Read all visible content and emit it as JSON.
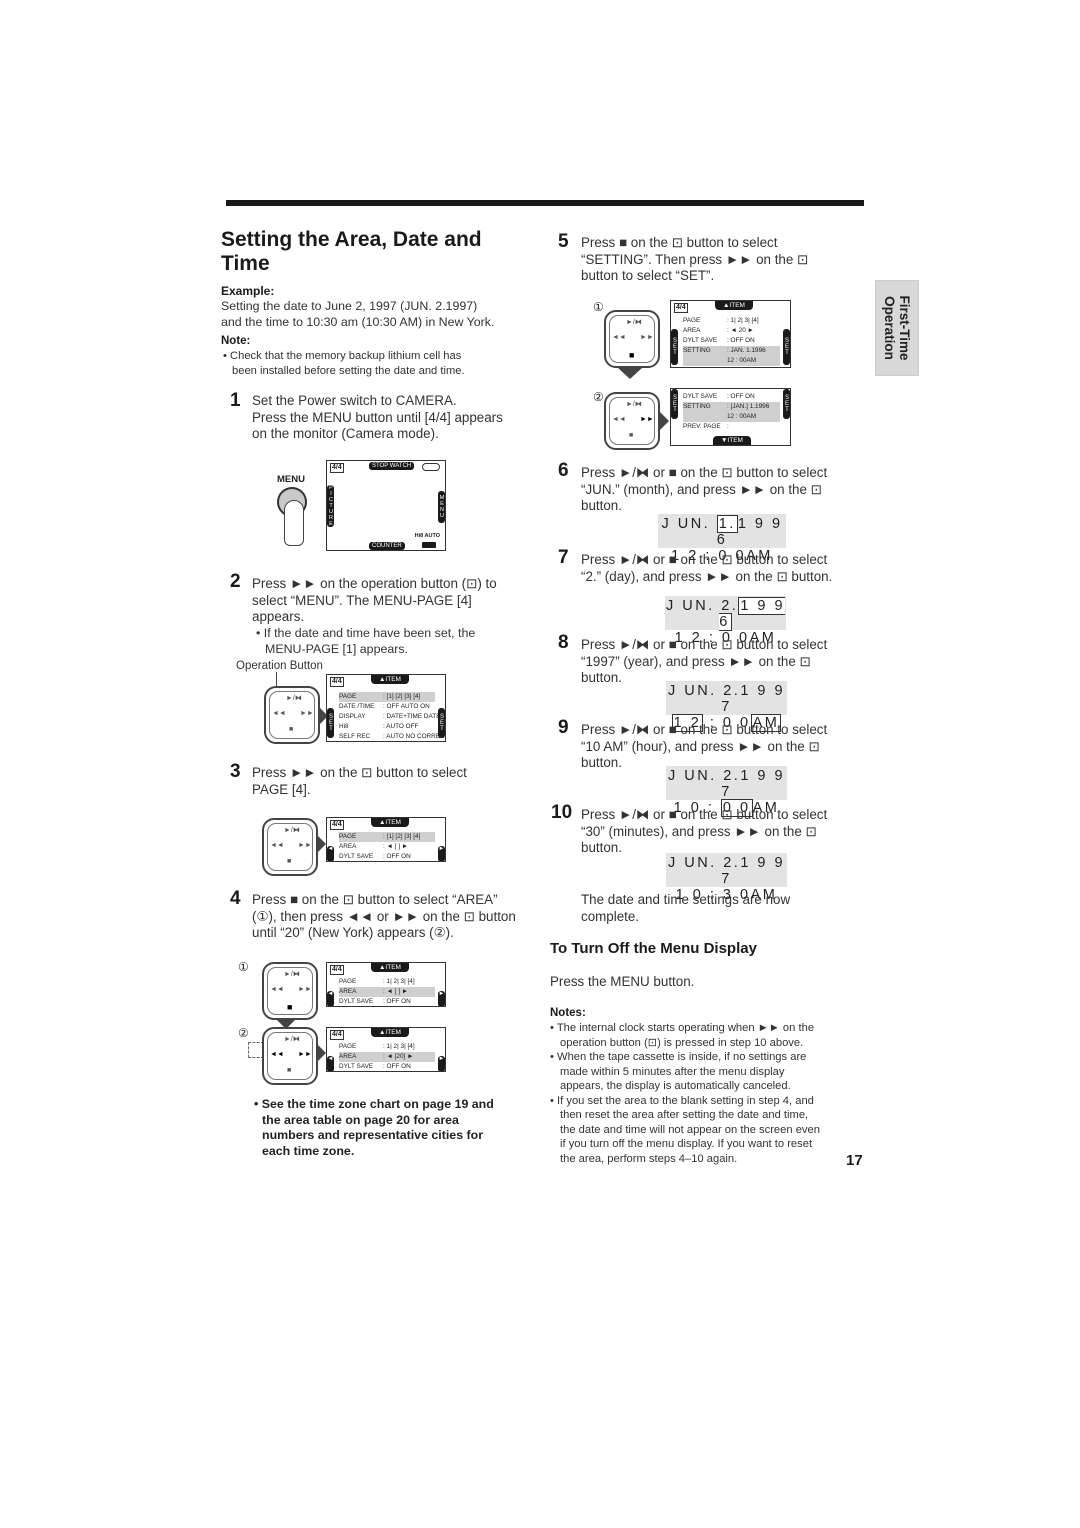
{
  "page": {
    "title": "Setting the Area, Date and Time",
    "section_tab": [
      "First-Time",
      "Operation"
    ],
    "page_number": "17"
  },
  "intro": {
    "example_label": "Example:",
    "example_lines": [
      "Setting the date to June 2, 1997 (JUN. 2.1997)",
      "and the time to 10:30 am (10:30 AM) in New York."
    ],
    "note_label": "Note:",
    "note_lines": [
      "• Check that the memory backup lithium cell has",
      "been installed before setting the date and time."
    ]
  },
  "steps": [
    {
      "num": "1",
      "lines": [
        "Set the Power switch to CAMERA.",
        "Press the MENU button until [4/4] appears",
        "on the monitor (Camera mode)."
      ]
    },
    {
      "num": "2",
      "lines": [
        "Press ►► on the operation button (⊡) to",
        "select “MENU”. The MENU-PAGE [4]",
        "appears."
      ],
      "bullet": [
        "• If the date and time have been set, the",
        "MENU-PAGE [1] appears."
      ]
    },
    {
      "num": "3",
      "lines": [
        "Press ►► on the ⊡ button to select",
        "PAGE [4]."
      ]
    },
    {
      "num": "4",
      "lines": [
        "Press ■ on the ⊡ button to select “AREA”",
        "(①), then press ◄◄ or ►► on the ⊡ button",
        "until “20” (New York) appears (②)."
      ]
    },
    {
      "num": "5",
      "lines": [
        "Press ■ on the ⊡ button to select",
        "“SETTING”. Then press ►► on the ⊡",
        "button to select “SET”."
      ]
    },
    {
      "num": "6",
      "lines": [
        "Press ►/⧓ or ■ on the ⊡ button to select",
        "“JUN.” (month), and press ►► on the ⊡",
        "button."
      ]
    },
    {
      "num": "7",
      "lines": [
        "Press ►/⧓ or ■ on the ⊡ button to select",
        "“2.” (day), and press ►► on the ⊡ button."
      ]
    },
    {
      "num": "8",
      "lines": [
        "Press ►/⧓ or ■ on the ⊡ button to select",
        "“1997” (year), and press ►► on the ⊡",
        "button."
      ]
    },
    {
      "num": "9",
      "lines": [
        "Press ►/⧓ or ■ on the ⊡ button to select",
        "“10 AM” (hour), and press ►► on the ⊡",
        "button."
      ]
    },
    {
      "num": "10",
      "lines": [
        "Press ►/⧓ or ■ on the ⊡ button to select",
        "“30” (minutes), and press ►► on the ⊡",
        "button."
      ]
    }
  ],
  "date_displays": [
    {
      "date": "J UN.",
      "day": "1.",
      "year": "1 9 9 6",
      "hour": "1 2",
      "min": "0 0",
      "ampm": "AM",
      "focus": "day"
    },
    {
      "date": "J UN.",
      "day": "2.",
      "year": "1 9 9 6",
      "hour": "1 2",
      "min": "0 0",
      "ampm": "AM",
      "focus": "year"
    },
    {
      "date": "J UN.",
      "day": "2.",
      "year": "1 9 9 7",
      "hour": "1 2",
      "min": "0 0",
      "ampm": "AM",
      "focus": "hour"
    },
    {
      "date": "J UN.",
      "day": "2.",
      "year": "1 9 9 7",
      "hour": "1 0",
      "min": "0 0",
      "ampm": "AM",
      "focus": "min"
    },
    {
      "date": "J UN.",
      "day": "2.",
      "year": "1 9 9 7",
      "hour": "1 0",
      "min": "3 0",
      "ampm": "AM",
      "focus": "none"
    }
  ],
  "complete_text": [
    "The date and time settings are now",
    "complete."
  ],
  "turn_off": {
    "heading": "To Turn Off the Menu Display",
    "text": "Press the MENU button."
  },
  "notes": {
    "label": "Notes:",
    "items": [
      [
        "• The internal clock starts operating when ►► on the",
        "operation button (⊡) is pressed in step 10 above."
      ],
      [
        "• When the tape cassette is inside, if no settings are",
        "made within 5 minutes after the menu display",
        "appears, the display is automatically canceled."
      ],
      [
        "• If you set the area to the blank setting in step 4, and",
        "then reset the area after setting the date and time,",
        "the date and time will not appear on the screen even",
        "if you turn off the menu display. If you want to reset",
        "the area, perform steps 4–10 again."
      ]
    ]
  },
  "see_also": [
    "• See the time zone chart on page 19 and",
    "the area table on page 20 for area",
    "numbers and representative cities for",
    "each time zone."
  ],
  "figures": {
    "menu_button_label": "MENU",
    "operation_button_label": "Operation Button",
    "circle_1": "①",
    "circle_2": "②",
    "pad_glyphs": {
      "play": "►/⧓",
      "rew": "◄◄",
      "ff": "►►",
      "stop": "■"
    },
    "camera_screen": {
      "badge": "4/4",
      "top": "STOP WATCH",
      "bottom": "COUNTER",
      "left": "PICTURE",
      "right": "MENU",
      "hi8": "Hi8 AUTO"
    },
    "menu_item_tab": "▲ITEM",
    "menu_item_tab_down": "▼ITEM",
    "set_label": "SET",
    "menu_page4_full": [
      {
        "k": "PAGE",
        "v": ": [1] [2] [3] [4]",
        "hl": true
      },
      {
        "k": "DATE /TIME",
        "v": ": OFF  AUTO  ON"
      },
      {
        "k": "DISPLAY",
        "v": ": DATE+TIME DATE"
      },
      {
        "k": "Hi8",
        "v": ": AUTO        OFF"
      },
      {
        "k": "SELF REC",
        "v": ": AUTO NO CORRECT"
      }
    ],
    "menu_area_step3": [
      {
        "k": "PAGE",
        "v": ": [1] [2] [3] [4]",
        "hl": true
      },
      {
        "k": "AREA",
        "v": ":    ◄ [  ] ►"
      },
      {
        "k": "DYLT SAVE",
        "v": ": OFF          ON"
      }
    ],
    "menu_area_step4a": [
      {
        "k": "PAGE",
        "v": ": 1| 2| 3| [4]"
      },
      {
        "k": "AREA",
        "v": ":    ◄ [  ] ►",
        "hl": true
      },
      {
        "k": "DYLT SAVE",
        "v": ": OFF          ON"
      }
    ],
    "menu_area_step4b": [
      {
        "k": "PAGE",
        "v": ": 1| 2| 3| [4]"
      },
      {
        "k": "AREA",
        "v": ":    ◄ [20] ►",
        "hl": true
      },
      {
        "k": "DYLT SAVE",
        "v": ": OFF          ON"
      }
    ],
    "menu_setting_5a": [
      {
        "k": "PAGE",
        "v": ": 1| 2| 3| [4]"
      },
      {
        "k": "AREA",
        "v": ":    ◄ 20 ►"
      },
      {
        "k": "DYLT SAVE",
        "v": ": OFF          ON"
      },
      {
        "k": "SETTING",
        "v": ": JAN.  1.1996",
        "hl": true
      },
      {
        "k": "",
        "v": "         12 : 00AM",
        "hl": true
      }
    ],
    "menu_setting_5b": [
      {
        "k": "DYLT SAVE",
        "v": ": OFF          ON"
      },
      {
        "k": "SETTING",
        "v": ": [JAN.]  1.1996",
        "hl": true
      },
      {
        "k": "",
        "v": "         12 : 00AM",
        "hl": true
      },
      {
        "k": "PREV. PAGE",
        "v": ":"
      }
    ]
  }
}
